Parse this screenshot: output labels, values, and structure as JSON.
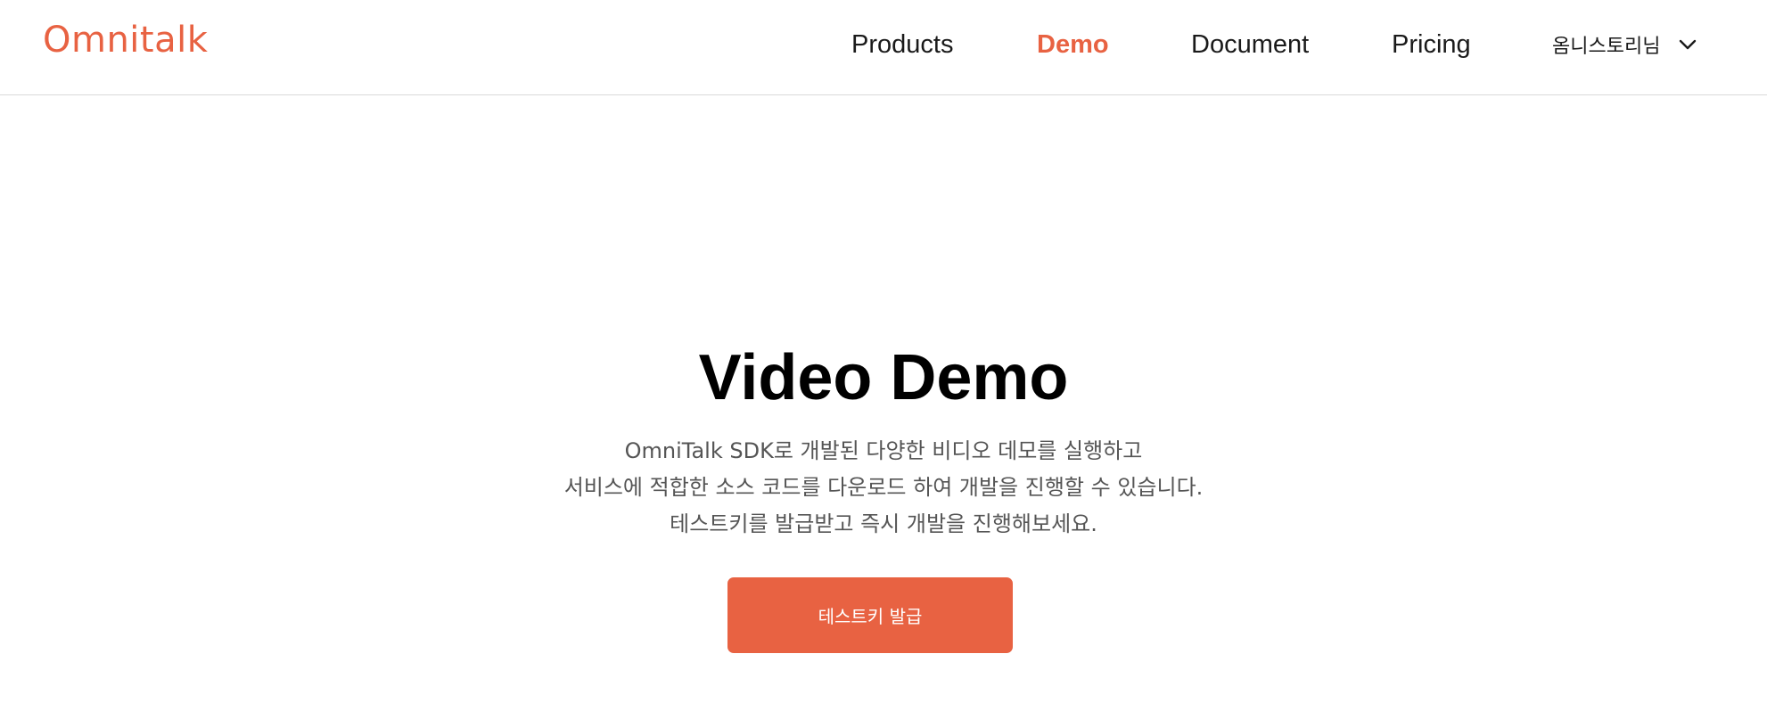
{
  "header": {
    "logo_text": "Omnitalk",
    "nav": [
      {
        "label": "Products",
        "active": false
      },
      {
        "label": "Demo",
        "active": true
      },
      {
        "label": "Document",
        "active": false
      },
      {
        "label": "Pricing",
        "active": false
      }
    ],
    "user": {
      "name": "옴니스토리님",
      "icon": "chevron-down-icon"
    }
  },
  "hero": {
    "title": "Video Demo",
    "description": [
      "OmniTalk SDK로 개발된 다양한 비디오 데모를 실행하고",
      "서비스에 적합한 소스 코드를 다운로드 하여 개발을 진행할 수 있습니다.",
      "테스트키를 발급받고 즉시 개발을 진행해보세요."
    ],
    "cta_label": "테스트키 발급"
  },
  "colors": {
    "accent": "#e86242",
    "text": "#1a1a1a",
    "muted": "#555555",
    "divider": "#d9d9d9"
  }
}
